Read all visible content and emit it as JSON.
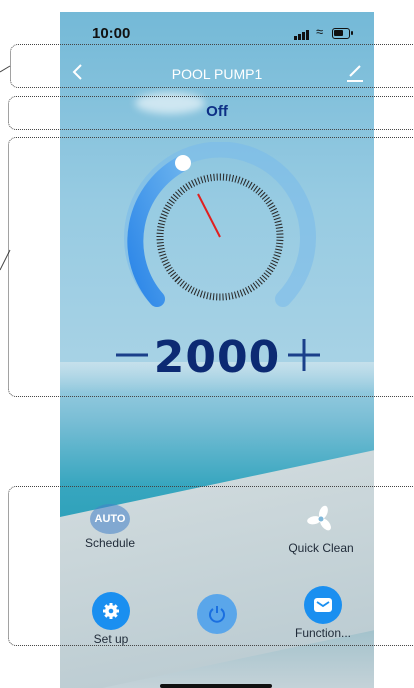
{
  "statusbar": {
    "time": "10:00"
  },
  "nav": {
    "title": "POOL PUMP1"
  },
  "device": {
    "status": "Off"
  },
  "speed": {
    "value": "2000",
    "minus_label": "−",
    "plus_label": "+"
  },
  "gauge": {
    "level_fraction": 0.25
  },
  "actions": {
    "schedule": {
      "label": "Schedule",
      "icon_text": "AUTO"
    },
    "quick_clean": {
      "label": "Quick Clean"
    }
  },
  "bottom": {
    "setup": {
      "label": "Set up"
    },
    "function": {
      "label": "Function..."
    }
  },
  "colors": {
    "accent": "#1a8ff0",
    "speed_text": "#0c2a73",
    "status_text": "#0d2f85"
  },
  "icons": [
    "back-icon",
    "edit-icon",
    "fan-icon",
    "gear-icon",
    "power-icon",
    "mail-icon"
  ]
}
